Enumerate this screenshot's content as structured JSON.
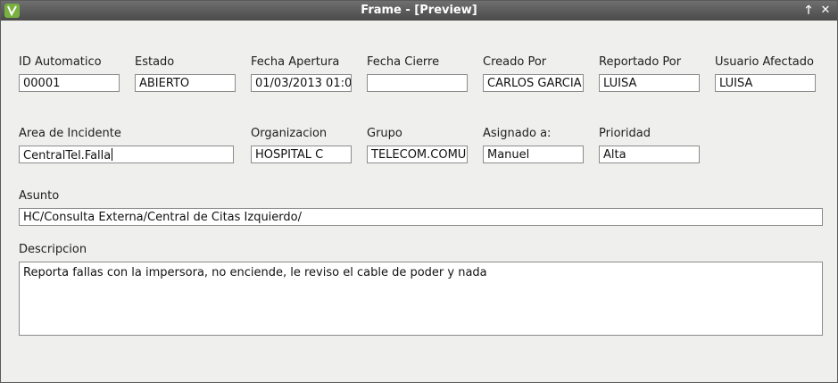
{
  "window": {
    "title": "Frame - [Preview]",
    "up_glyph": "🡑",
    "close_glyph": "✕"
  },
  "labels": {
    "id": "ID Automatico",
    "estado": "Estado",
    "fecha_apertura": "Fecha Apertura",
    "fecha_cierre": "Fecha Cierre",
    "creado_por": "Creado Por",
    "reportado_por": "Reportado Por",
    "usuario_afectado": "Usuario Afectado",
    "area_incidente": "Area de Incidente",
    "organizacion": "Organizacion",
    "grupo": "Grupo",
    "asignado": "Asignado a:",
    "prioridad": "Prioridad",
    "asunto": "Asunto",
    "descripcion": "Descripcion"
  },
  "values": {
    "id": "00001",
    "estado": "ABIERTO",
    "fecha_apertura": "01/03/2013 01:0",
    "fecha_cierre": "",
    "creado_por": "CARLOS GARCIA",
    "reportado_por": "LUISA",
    "usuario_afectado": "LUISA",
    "area_incidente": "CentralTel.Falla",
    "organizacion": "HOSPITAL C",
    "grupo": "TELECOM.COMU",
    "asignado": "Manuel",
    "prioridad": "Alta",
    "asunto": "HC/Consulta Externa/Central de Citas Izquierdo/",
    "descripcion": "Reporta fallas con la impersora, no enciende, le reviso el cable de poder y nada"
  }
}
